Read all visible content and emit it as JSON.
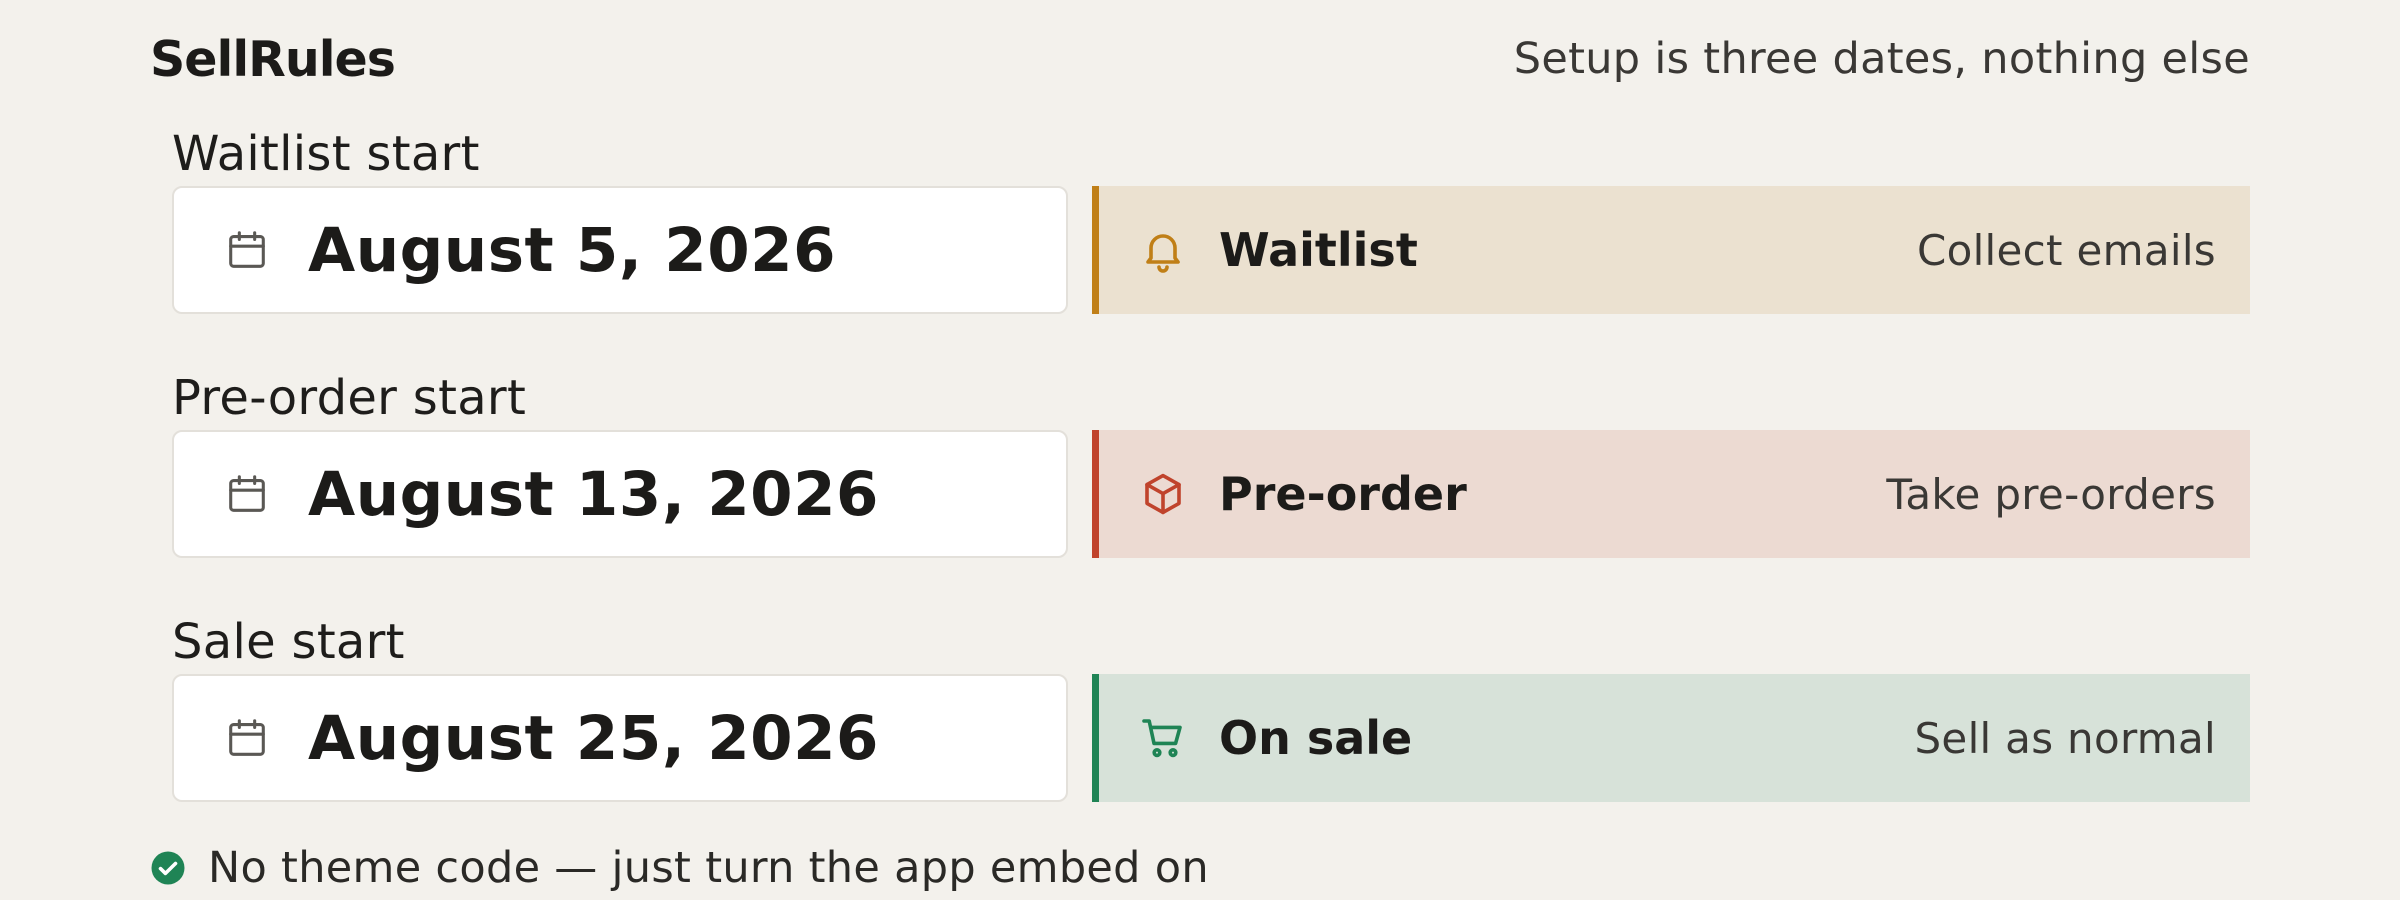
{
  "app": {
    "brand": "SellRules",
    "tagline": "Setup is three dates, nothing else"
  },
  "rows": [
    {
      "label": "Waitlist start",
      "date": "August 5, 2026",
      "status_title": "Waitlist",
      "status_desc": "Collect emails",
      "status_icon": "bell-icon",
      "accent": "#c07f17",
      "bg": "#ebe1d0"
    },
    {
      "label": "Pre-order start",
      "date": "August 13, 2026",
      "status_title": "Pre-order",
      "status_desc": "Take pre-orders",
      "status_icon": "box-icon",
      "accent": "#c0432c",
      "bg": "#ecdad2"
    },
    {
      "label": "Sale start",
      "date": "August 25, 2026",
      "status_title": "On sale",
      "status_desc": "Sell as normal",
      "status_icon": "cart-icon",
      "accent": "#1f8455",
      "bg": "#d7e2d9"
    }
  ],
  "footer": {
    "text": "No theme code — just turn the app embed on",
    "icon": "check-circle-icon",
    "icon_color": "#1f8455"
  }
}
